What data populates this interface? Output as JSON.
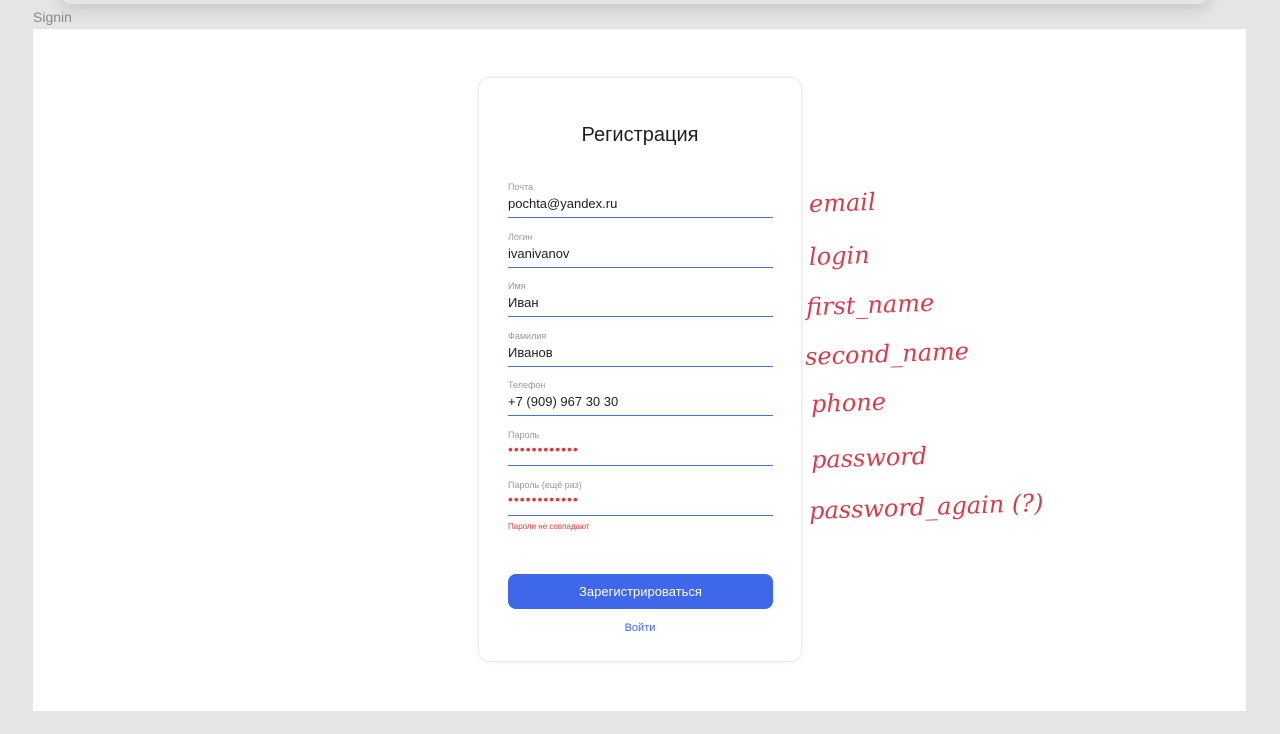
{
  "frame_label": "Signin",
  "form": {
    "title": "Регистрация",
    "fields": [
      {
        "label": "Почта",
        "value": "pochta@yandex.ru"
      },
      {
        "label": "Логин",
        "value": "ivanivanov"
      },
      {
        "label": "Имя",
        "value": "Иван"
      },
      {
        "label": "Фамилия",
        "value": "Иванов"
      },
      {
        "label": "Телефон",
        "value": "+7 (909) 967 30 30"
      },
      {
        "label": "Пароль",
        "value": "••••••••••••"
      },
      {
        "label": "Пароль (ещё раз)",
        "value": "••••••••••••"
      }
    ],
    "error": "Пароли не совпадают",
    "submit_label": "Зарегистрироваться",
    "login_link": "Войти"
  },
  "annotations": [
    "email",
    "login",
    "first_name",
    "second_name",
    "phone",
    "password",
    "password_again (?)"
  ],
  "colors": {
    "accent": "#3e67ea",
    "error": "#e0393e",
    "annotation": "#d83c4a",
    "field_line": "#4a6fd0"
  }
}
